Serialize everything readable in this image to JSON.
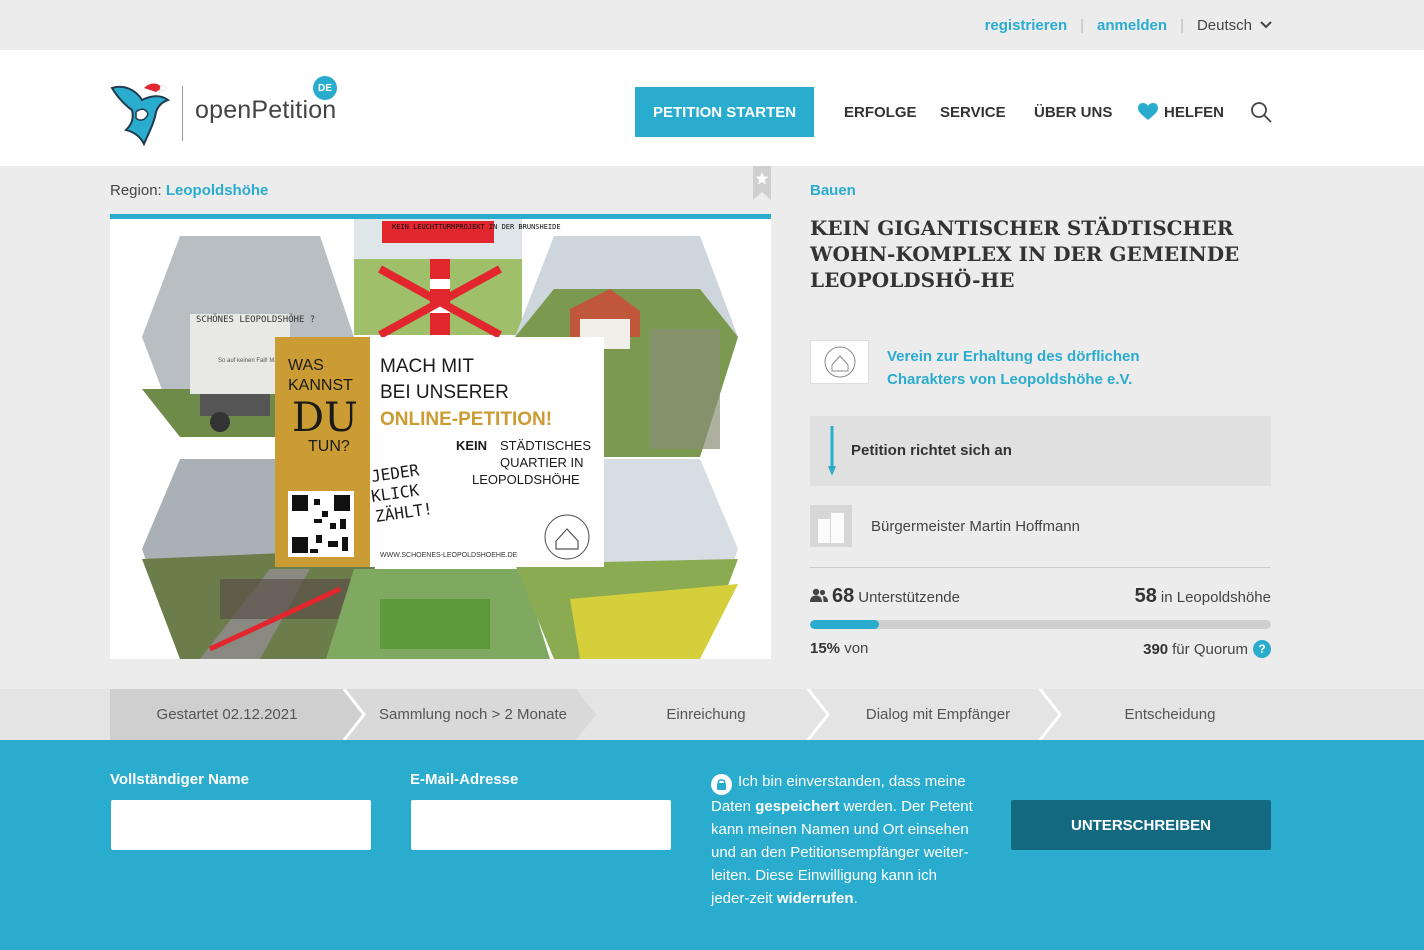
{
  "topbar": {
    "register": "registrieren",
    "login": "anmelden",
    "language": "Deutsch"
  },
  "header": {
    "logo_text": "openPetition",
    "logo_badge": "DE",
    "start_button": "PETITION STARTEN",
    "nav": {
      "erfolge": "ERFOLGE",
      "service": "SERVICE",
      "ueber_uns": "ÜBER UNS",
      "helfen": "HELFEN"
    }
  },
  "petition": {
    "region_label": "Region:",
    "region": "Leopoldshöhe",
    "category": "Bauen",
    "title": "KEIN GIGANTISCHER STÄDTISCHER WOHN-KOMPLEX IN DER GEMEINDE LEOPOLDSHÖ-HE",
    "organization": "Verein zur Erhaltung des dörflichen Charakters von Leopoldshöhe e.V.",
    "recipient_label": "Petition richtet sich an",
    "recipient": "Bürgermeister Martin Hoffmann",
    "supporters_count": "68",
    "supporters_label": "Unterstützende",
    "local_count": "58",
    "local_label": "in Leopoldshöhe",
    "progress_fraction": 0.15,
    "percent": "15%",
    "percent_suffix": "von",
    "quorum_count": "390",
    "quorum_label": "für Quorum",
    "help_glyph": "?"
  },
  "image": {
    "poster_banner": "KEIN LEUCHTTURMPROJEKT IN DER BRUNSHEIDE",
    "sign_line1": "SCHÖNES LEOPOLDSHÖHE ?",
    "sign_line2": "So auf keinen Fall! Mach mit!",
    "side_was": "WAS",
    "side_kannst": "KANNST",
    "side_du": "DU",
    "side_tun": "TUN?",
    "headline1": "MACH MIT",
    "headline2": "BEI UNSERER",
    "headline3": "ONLINE-PETITION!",
    "sub_kein": "KEIN",
    "sub1": "STÄDTISCHES",
    "sub2": "QUARTIER IN",
    "sub3": "LEOPOLDSHÖHE",
    "hand1": "JEDER",
    "hand2": "KLICK",
    "hand3": "ZÄHLT!",
    "url": "WWW.SCHOENES-LEOPOLDSHOEHE.DE"
  },
  "steps": [
    {
      "label": "Gestartet 02.12.2021"
    },
    {
      "label": "Sammlung noch > 2 Monate"
    },
    {
      "label": "Einreichung"
    },
    {
      "label": "Dialog mit Empfänger"
    },
    {
      "label": "Entscheidung"
    }
  ],
  "form": {
    "name_label": "Vollständiger Name",
    "email_label": "E-Mail-Adresse",
    "consent_1": "Ich bin einverstanden, dass meine Daten",
    "consent_bold1": "gespeichert",
    "consent_2": "werden. Der Petent kann meinen Namen und Ort einsehen und an den Petitionsempfänger weiter-leiten. Diese Einwilligung kann ich jeder-zeit",
    "consent_bold2": "widerrufen",
    "consent_3": ".",
    "submit": "UNTERSCHREIBEN"
  },
  "colors": {
    "accent": "#2aaccf",
    "dark_button": "#136a80",
    "background": "#ececec"
  }
}
